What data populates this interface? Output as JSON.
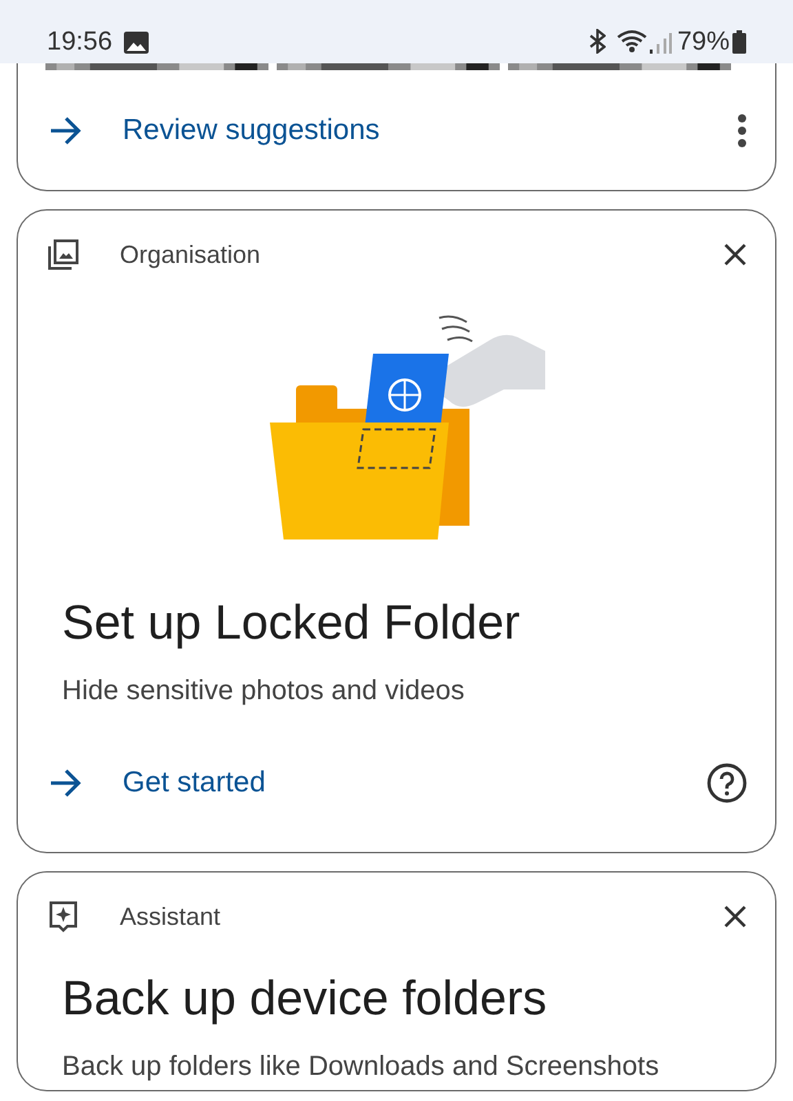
{
  "status_bar": {
    "time": "19:56",
    "battery": "79%"
  },
  "cards": [
    {
      "kind": "suggestions",
      "action": {
        "label": "Review suggestions"
      }
    },
    {
      "kind": "locked-folder",
      "category": "Organisation",
      "title": "Set up Locked Folder",
      "description": "Hide sensitive photos and videos",
      "action": {
        "label": "Get started"
      }
    },
    {
      "kind": "backup",
      "category": "Assistant",
      "title": "Back up device folders",
      "description": "Back up folders like Downloads and Screenshots"
    }
  ]
}
